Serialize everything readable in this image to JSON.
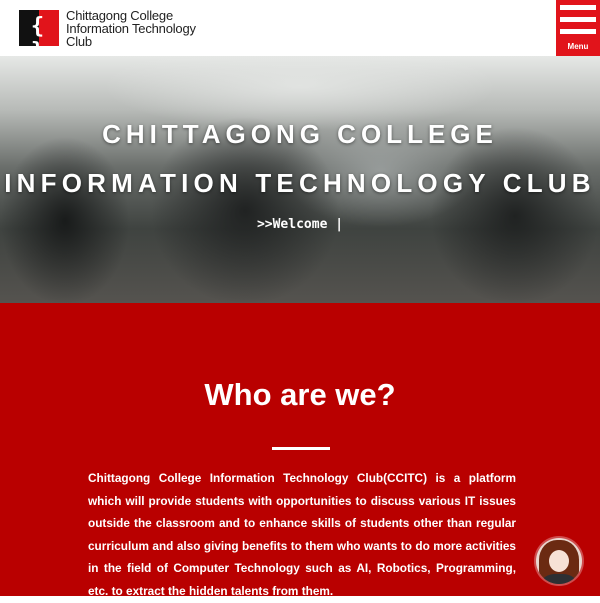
{
  "header": {
    "logo_glyph": "{ }",
    "logo_lines": [
      "Chittagong College",
      "Information Technology",
      "Club"
    ],
    "menu_label": "Menu"
  },
  "hero": {
    "title_line1": "CHITTAGONG COLLEGE",
    "title_line2": "INFORMATION TECHNOLOGY CLUB",
    "typing_text": ">>Welcome |"
  },
  "about": {
    "heading": "Who are we?",
    "body": "Chittagong College Information Technology Club(CCITC) is a platform which will provide students with opportunities to discuss various IT issues outside the classroom and to enhance skills of students other than regular curriculum and also giving benefits to them who wants to do more activities in the field of Computer Technology such as AI, Robotics, Programming, etc. to extract the hidden talents from them."
  },
  "colors": {
    "brand_red": "#e1141b",
    "section_red": "#b90000"
  }
}
